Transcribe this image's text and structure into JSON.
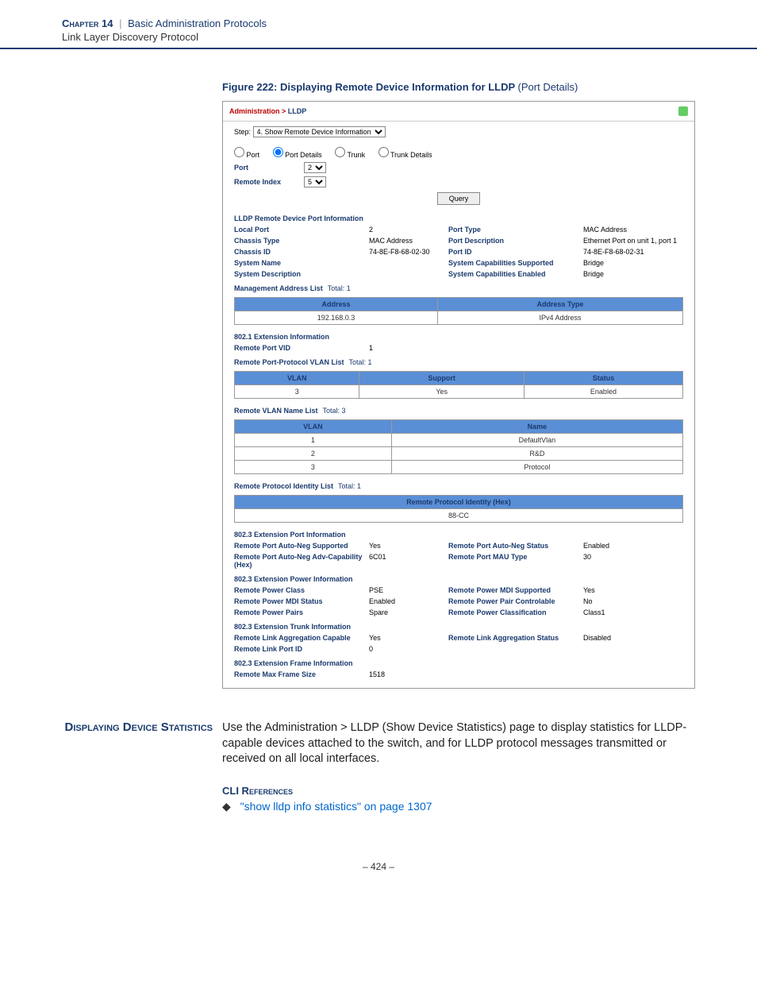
{
  "header": {
    "chapter": "Chapter 14",
    "pipe": "|",
    "section": "Basic Administration Protocols",
    "sub": "Link Layer Discovery Protocol"
  },
  "figure": {
    "num": "Figure 222:",
    "title": "Displaying Remote Device Information for LLDP",
    "subtitle": "(Port Details)"
  },
  "crumb": {
    "a": "Administration >",
    "b": "LLDP"
  },
  "step": {
    "label": "Step:",
    "value": "4. Show Remote Device Information"
  },
  "radios": {
    "port": "Port",
    "port_details": "Port Details",
    "trunk": "Trunk",
    "trunk_details": "Trunk Details"
  },
  "selectors": {
    "port_label": "Port",
    "port_val": "2",
    "remote_index_label": "Remote Index",
    "remote_index_val": "5"
  },
  "query": "Query",
  "sec1": {
    "title": "LLDP Remote Device Port Information",
    "rows": [
      [
        "Local Port",
        "2",
        "Port Type",
        "MAC Address"
      ],
      [
        "Chassis Type",
        "MAC Address",
        "Port Description",
        "Ethernet Port on unit 1, port 1"
      ],
      [
        "Chassis ID",
        "74-8E-F8-68-02-30",
        "Port ID",
        "74-8E-F8-68-02-31"
      ],
      [
        "System Name",
        "",
        "System Capabilities Supported",
        "Bridge"
      ],
      [
        "System Description",
        "",
        "System Capabilities Enabled",
        "Bridge"
      ]
    ]
  },
  "mgmt": {
    "title": "Management Address List",
    "total": "Total: 1",
    "headers": [
      "Address",
      "Address Type"
    ],
    "row": [
      "192.168.0.3",
      "IPv4 Address"
    ]
  },
  "ext8021": {
    "title": "802.1 Extension Information",
    "rpvid_label": "Remote Port VID",
    "rpvid_val": "1",
    "vlan_list_title": "Remote Port-Protocol VLAN List",
    "vlan_list_total": "Total: 1",
    "vlan_headers": [
      "VLAN",
      "Support",
      "Status"
    ],
    "vlan_row": [
      "3",
      "Yes",
      "Enabled"
    ],
    "vname_title": "Remote VLAN Name List",
    "vname_total": "Total: 3",
    "vname_headers": [
      "VLAN",
      "Name"
    ],
    "vname_rows": [
      [
        "1",
        "DefaultVlan"
      ],
      [
        "2",
        "R&D"
      ],
      [
        "3",
        "Protocol"
      ]
    ],
    "proto_title": "Remote Protocol Identity List",
    "proto_total": "Total: 1",
    "proto_header": "Remote Protocol Identity (Hex)",
    "proto_row": "88-CC"
  },
  "ext8023_port": {
    "title": "802.3 Extension Port Information",
    "rows": [
      [
        "Remote Port Auto-Neg Supported",
        "Yes",
        "Remote Port Auto-Neg Status",
        "Enabled"
      ],
      [
        "Remote Port Auto-Neg Adv-Capability (Hex)",
        "6C01",
        "Remote Port MAU Type",
        "30"
      ]
    ]
  },
  "ext8023_power": {
    "title": "802.3 Extension Power Information",
    "rows": [
      [
        "Remote Power Class",
        "PSE",
        "Remote Power MDI Supported",
        "Yes"
      ],
      [
        "Remote Power MDI Status",
        "Enabled",
        "Remote Power Pair Controlable",
        "No"
      ],
      [
        "Remote Power Pairs",
        "Spare",
        "Remote Power Classification",
        "Class1"
      ]
    ]
  },
  "ext8023_trunk": {
    "title": "802.3 Extension Trunk Information",
    "rows": [
      [
        "Remote Link Aggregation Capable",
        "Yes",
        "Remote Link Aggregation Status",
        "Disabled"
      ],
      [
        "Remote Link Port ID",
        "0",
        "",
        ""
      ]
    ]
  },
  "ext8023_frame": {
    "title": "802.3 Extension Frame Information",
    "rows": [
      [
        "Remote Max Frame Size",
        "1518",
        "",
        ""
      ]
    ]
  },
  "body": {
    "side": "Displaying Device Statistics",
    "para": "Use the Administration > LLDP (Show Device Statistics) page to display statistics for LLDP-capable devices attached to the switch, and for LLDP protocol messages transmitted or received on all local interfaces."
  },
  "cli": {
    "heading": "CLI References",
    "link": "\"show lldp info statistics\" on page 1307"
  },
  "pagenum": "– 424 –"
}
